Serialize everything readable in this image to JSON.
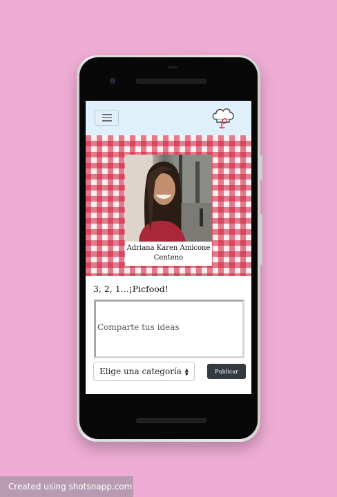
{
  "colors": {
    "background": "#efadd5",
    "navbar": "#dff0fb",
    "tablecloth_red": "#cd1634",
    "publish_button": "#343a40"
  },
  "navbar": {
    "menu_icon": "hamburger-icon",
    "logo_icon": "chef-hat-logo-icon"
  },
  "profile": {
    "name": "Adriana Karen Amicone Centeno"
  },
  "post": {
    "title": "3, 2, 1...¡Picfood!",
    "textarea_placeholder": "Comparte tus ideas",
    "category_selected": "Elige una categoría",
    "publish_label": "Publicar"
  },
  "watermark": {
    "text": "Created using shotsnapp.com"
  }
}
